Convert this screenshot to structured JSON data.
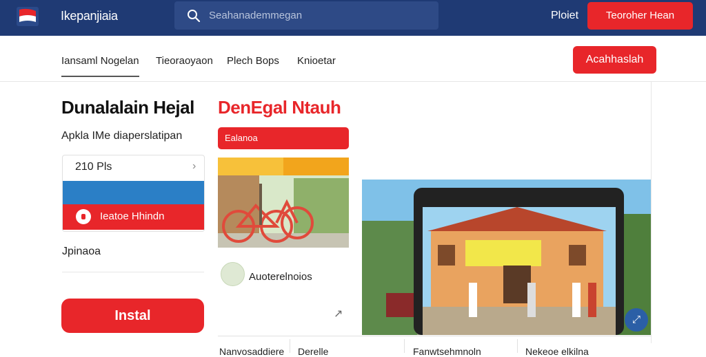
{
  "header": {
    "brand": "Ikepanjiaia",
    "search_placeholder": "Seahanademmegan",
    "link": "Ploiet",
    "cta": "Teoroher Hean"
  },
  "nav": {
    "items": [
      "Iansaml Nogelan",
      "Tieoraoyaon",
      "Plech Bops",
      "Knioetar"
    ],
    "cta": "Acahhaslah"
  },
  "left": {
    "title": "Dunalalain Hejal",
    "subtitle": "Apkla IMe diaperslatipan",
    "card": {
      "row_label": "210 Pls",
      "red_label": "Ieatoe Hhindn"
    },
    "section_label": "Jpinaoa",
    "install": "Instal"
  },
  "middle": {
    "title": "DenEgal Ntauh",
    "pill": "Ealanoa",
    "row_label": "Auoterelnoios"
  },
  "bottom": {
    "cells": [
      "Nanvosaddiere",
      "Derelle",
      "Fanwtsehmnoln",
      "Nekeoe elkilna"
    ]
  },
  "colors": {
    "header_bg": "#1f3a74",
    "accent_red": "#e8262a",
    "accent_blue": "#2b7fc6"
  },
  "icons": {
    "logo": "flag-logo",
    "search": "search-icon",
    "arrow": "chevron-right-icon",
    "fab": "expand-icon"
  }
}
